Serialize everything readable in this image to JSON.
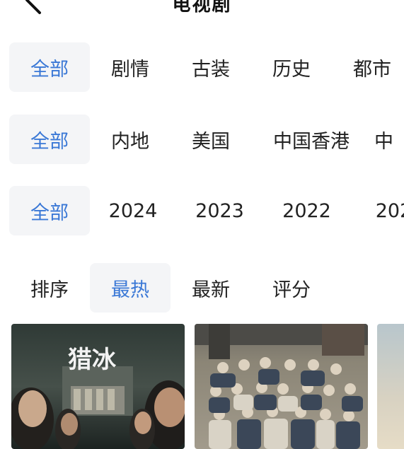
{
  "header": {
    "title": "电视剧",
    "back_icon": "chevron-left-icon"
  },
  "filters": {
    "genre": [
      "全部",
      "剧情",
      "古装",
      "历史",
      "都市"
    ],
    "region": [
      "全部",
      "内地",
      "美国",
      "中国香港",
      "中"
    ],
    "year": [
      "全部",
      "2024",
      "2023",
      "2022",
      "202"
    ],
    "sort": [
      "排序",
      "最热",
      "最新",
      "评分"
    ]
  },
  "posters": [
    {
      "title_art": "猎冰"
    },
    {
      "title_art": ""
    },
    {
      "title_art": ""
    }
  ],
  "colors": {
    "accent": "#3a78d6",
    "chip_bg": "#f4f5f7",
    "text": "#222222"
  }
}
